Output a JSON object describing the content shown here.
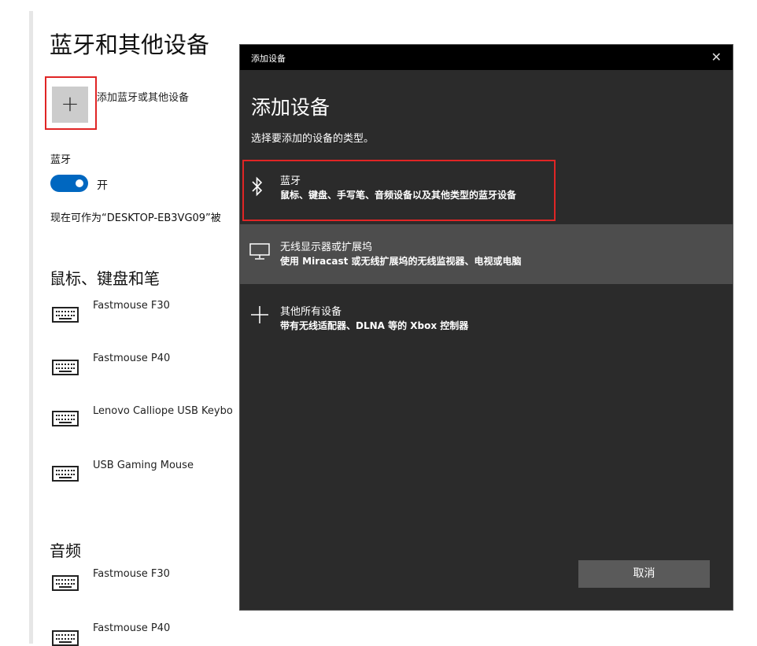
{
  "settings": {
    "title": "蓝牙和其他设备",
    "add_button_symbol": "+",
    "add_label": "添加蓝牙或其他设备",
    "bluetooth_label": "蓝牙",
    "bluetooth_state": "开",
    "discoverable_text": "现在可作为“DESKTOP-EB3VG09”被",
    "sections": {
      "mice_keyboards": "鼠标、键盘和笔",
      "audio": "音频"
    },
    "mice_keyboards_devices": [
      "Fastmouse F30",
      "Fastmouse P40",
      "Lenovo Calliope USB Keybo",
      "USB Gaming Mouse"
    ],
    "audio_devices": [
      "Fastmouse F30",
      "Fastmouse P40"
    ],
    "accent_color": "#0067c0"
  },
  "dialog": {
    "window_title": "添加设备",
    "close_symbol": "✕",
    "heading": "添加设备",
    "subtitle": "选择要添加的设备的类型。",
    "options": [
      {
        "icon": "bluetooth-icon",
        "title": "蓝牙",
        "description": "鼠标、键盘、手写笔、音频设备以及其他类型的蓝牙设备"
      },
      {
        "icon": "monitor-icon",
        "title": "无线显示器或扩展坞",
        "description": "使用 Miracast 或无线扩展坞的无线监视器、电视或电脑"
      },
      {
        "icon": "plus-icon",
        "title": "其他所有设备",
        "description": "带有无线适配器、DLNA 等的 Xbox 控制器"
      }
    ],
    "cancel_label": "取消"
  }
}
